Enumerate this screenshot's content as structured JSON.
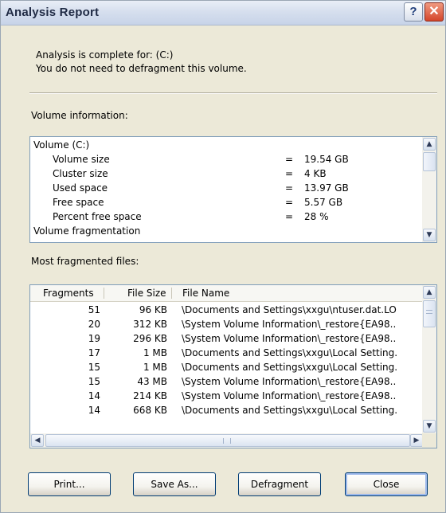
{
  "window": {
    "title": "Analysis Report",
    "help_glyph": "?",
    "close_glyph": "✕"
  },
  "summary": {
    "line1": "Analysis is complete for: (C:)",
    "line2": "You do not need to defragment this volume."
  },
  "volume_section": {
    "label": "Volume information:",
    "lines": [
      {
        "name": "Volume (C:)",
        "eq": "",
        "value": ""
      },
      {
        "name": "Volume size",
        "eq": "=",
        "value": "19.54 GB"
      },
      {
        "name": "Cluster size",
        "eq": "=",
        "value": "4 KB"
      },
      {
        "name": "Used space",
        "eq": "=",
        "value": "13.97 GB"
      },
      {
        "name": "Free space",
        "eq": "=",
        "value": "5.57 GB"
      },
      {
        "name": "Percent free space",
        "eq": "=",
        "value": "28 %"
      },
      {
        "name": "Volume fragmentation",
        "eq": "",
        "value": ""
      }
    ]
  },
  "files_section": {
    "label": "Most fragmented files:",
    "columns": [
      "Fragments",
      "File Size",
      "File Name"
    ],
    "rows": [
      {
        "fragments": "51",
        "size": "96 KB",
        "name": "\\Documents and Settings\\xxgu\\ntuser.dat.LO"
      },
      {
        "fragments": "20",
        "size": "312 KB",
        "name": "\\System Volume Information\\_restore{EA98.."
      },
      {
        "fragments": "19",
        "size": "296 KB",
        "name": "\\System Volume Information\\_restore{EA98.."
      },
      {
        "fragments": "17",
        "size": "1 MB",
        "name": "\\Documents and Settings\\xxgu\\Local Setting."
      },
      {
        "fragments": "15",
        "size": "1 MB",
        "name": "\\Documents and Settings\\xxgu\\Local Setting."
      },
      {
        "fragments": "15",
        "size": "43 MB",
        "name": "\\System Volume Information\\_restore{EA98.."
      },
      {
        "fragments": "14",
        "size": "214 KB",
        "name": "\\System Volume Information\\_restore{EA98.."
      },
      {
        "fragments": "14",
        "size": "668 KB",
        "name": "\\Documents and Settings\\xxgu\\Local Setting."
      }
    ]
  },
  "buttons": {
    "print": "Print...",
    "save_as": "Save As...",
    "defragment": "Defragment",
    "close": "Close"
  },
  "icons": {
    "up": "chevron-up-icon",
    "down": "chevron-down-icon",
    "left": "chevron-left-icon",
    "right": "chevron-right-icon",
    "grip": "grip-icon"
  }
}
